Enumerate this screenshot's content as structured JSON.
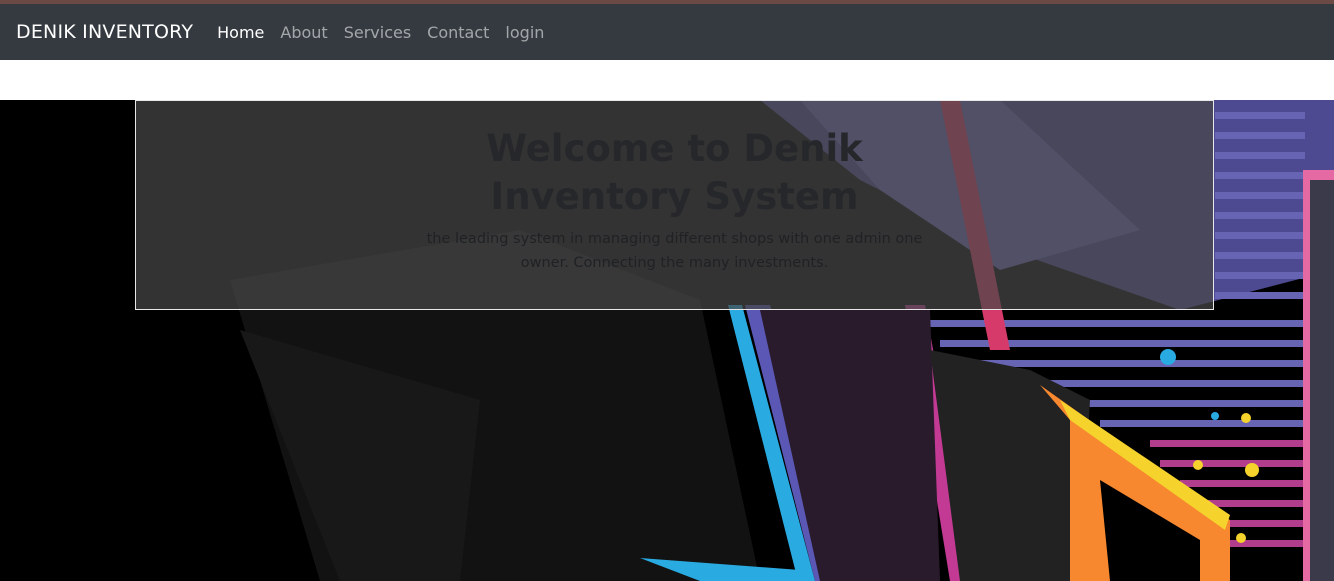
{
  "navbar": {
    "brand": "DENIK INVENTORY",
    "links": [
      {
        "label": "Home",
        "active": true
      },
      {
        "label": "About",
        "active": false
      },
      {
        "label": "Services",
        "active": false
      },
      {
        "label": "Contact",
        "active": false
      },
      {
        "label": "login",
        "active": false
      }
    ]
  },
  "jumbotron": {
    "title": "Welcome to Denik Inventory System",
    "lead": "the leading system in managing different shops with one admin one owner. Connecting the many investments."
  },
  "colors": {
    "navbar_bg": "#343a40",
    "nav_active": "#ffffff",
    "nav_inactive": "#9a9da1",
    "hero_bg": "#000000",
    "accent_blue": "#29abe2",
    "accent_pink": "#d63a8a",
    "accent_purple": "#5b57b5",
    "accent_orange": "#f7882f",
    "accent_yellow": "#f5d22c"
  },
  "hero_image": {
    "icon": "abstract-graphic-illustration"
  }
}
